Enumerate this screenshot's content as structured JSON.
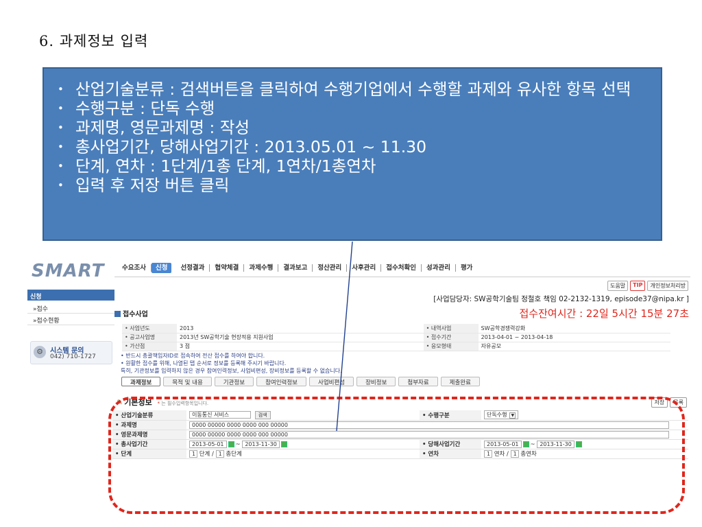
{
  "slide": {
    "title": "6. 과제정보 입력",
    "bullets": [
      "산업기술분류 : 검색버튼을 클릭하여 수행기업에서 수행할 과제와 유사한 항목 선택",
      "수행구분 : 단독 수행",
      "과제명, 영문과제명 : 작성",
      "총사업기간, 당해사업기간 : 2013.05.01 ~ 11.30",
      "단계, 연차 : 1단계/1총 단계, 1연차/1총연차",
      "입력 후 저장 버튼 클릭"
    ]
  },
  "app": {
    "logo": "SMART",
    "sidebar": {
      "header": "신청",
      "items": [
        "»접수",
        "»접수현황"
      ],
      "system_inquiry": {
        "title": "시스템 문의",
        "phone": "042) 710-1727"
      }
    },
    "nav": [
      "수요조사",
      "신청",
      "선정결과",
      "협약체결",
      "과제수행",
      "결과보고",
      "정산관리",
      "사후관리",
      "접수처확인",
      "성과관리",
      "평가"
    ],
    "nav_active": "신청",
    "tools": [
      "도움말",
      "TIP",
      "개인정보처리방"
    ],
    "contact": "[사업담당자: SW공학기술팀 정철호 책임 02-2132-1319, episode37@nipa.kr ]",
    "section_title": "접수사업",
    "remaining_time": "접수잔여시간 : 22일 5시간 15분 27초",
    "info": [
      {
        "label": "• 사업년도",
        "value": "2013",
        "label2": "• 내역사업",
        "value2": "SW공학경쟁력강화"
      },
      {
        "label": "• 공고사업명",
        "value": "2013년 SW공학기술 현장적용 지원사업",
        "label2": "• 접수기간",
        "value2": "2013-04-01 ~ 2013-04-18"
      },
      {
        "label": "• 가산점",
        "value": "3 점",
        "label2": "• 응모형태",
        "value2": "자유공모"
      }
    ],
    "notices": [
      "• 반드시 총괄책임자ID로 접속하여 전산 접수를 하여야 합니다.",
      "• 원활한 접수를 위해, 나열된 탭 순서로 정보를 등록해 주시기 바랍니다.",
      "특히, 기관정보를 입력하지 않은 경우 참여인력정보, 사업비편성, 장비정보를 등록할 수 없습니다."
    ],
    "tabs": [
      "과제정보",
      "목적 및 내용",
      "기관정보",
      "참여인력정보",
      "사업비편성",
      "장비정보",
      "첨부자료",
      "제출완료"
    ],
    "basic": {
      "title": "기본정보",
      "required_mark": "*",
      "note": "는 필수입력항목입니다.",
      "save_label": "저장",
      "list_label": "목록"
    },
    "form": {
      "industry_label": "• 산업기술분류",
      "industry_value": "이동통신 서비스",
      "search_label": "검색",
      "type_label": "• 수행구분",
      "type_value": "단독수행",
      "project_name_label": "• 과제명",
      "project_name_value": "0000 00000 0000 0000 000 00000",
      "eng_name_label": "• 영문과제명",
      "eng_name_value": "0000 00000 0000 0000 000 00000",
      "total_period_label": "• 총사업기간",
      "total_start": "2013-05-01",
      "total_end": "2013-11-30",
      "year_period_label": "• 당해사업기간",
      "year_start": "2013-05-01",
      "year_end": "2013-11-30",
      "stage_label": "• 단계",
      "stage_value": "1",
      "stage_unit": "단계 /",
      "stage_total": "1",
      "stage_total_unit": "총단계",
      "year_label": "• 연차",
      "year_value": "1",
      "year_unit": "연차 /",
      "year_total": "1",
      "year_total_unit": "총연차"
    }
  }
}
